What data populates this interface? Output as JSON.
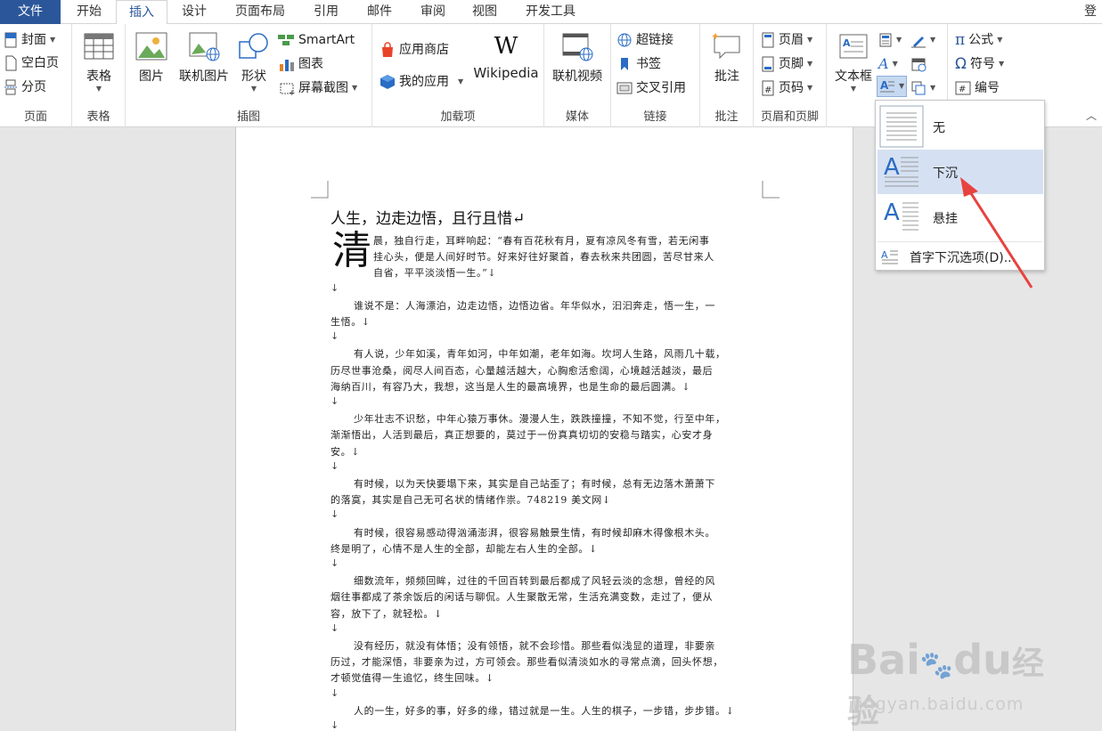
{
  "tabs": [
    {
      "label": "文件"
    },
    {
      "label": "开始"
    },
    {
      "label": "插入"
    },
    {
      "label": "设计"
    },
    {
      "label": "页面布局"
    },
    {
      "label": "引用"
    },
    {
      "label": "邮件"
    },
    {
      "label": "审阅"
    },
    {
      "label": "视图"
    },
    {
      "label": "开发工具"
    }
  ],
  "login": "登录",
  "ribbon": {
    "pages": {
      "cover": "封面",
      "blank": "空白页",
      "break": "分页",
      "label": "页面"
    },
    "table": {
      "table": "表格",
      "label": "表格"
    },
    "illustrations": {
      "picture": "图片",
      "online_picture": "联机图片",
      "shapes": "形状",
      "smartart": "SmartArt",
      "chart": "图表",
      "screenshot": "屏幕截图",
      "label": "插图"
    },
    "addins": {
      "store": "应用商店",
      "my_apps": "我的应用",
      "wikipedia": "Wikipedia",
      "label": "加载项"
    },
    "media": {
      "online_video": "联机视频",
      "label": "媒体"
    },
    "links": {
      "hyperlink": "超链接",
      "bookmark": "书签",
      "cross_ref": "交叉引用",
      "label": "链接"
    },
    "comments": {
      "comment": "批注",
      "label": "批注"
    },
    "header_footer": {
      "header": "页眉",
      "footer": "页脚",
      "page_number": "页码",
      "label": "页眉和页脚"
    },
    "text": {
      "textbox": "文本框"
    },
    "symbols": {
      "equation": "公式",
      "symbol": "符号",
      "numbering": "编号"
    }
  },
  "document": {
    "title": "人生，边走边悟，且行且惜↵",
    "dropcap": "清",
    "lines": [
      "晨，独自行走，耳畔响起：“春有百花秋有月，夏有凉风冬有雪，若无闲事",
      "挂心头，便是人间好时节。好来好往好聚首，春去秋来共团圆，苦尽甘来人",
      "自省，平平淡淡悟一生。”↓",
      "↓",
      "谁说不是：人海漂泊，边走边悟，边悟边省。年华似水，汩汩奔走，悟一生，一",
      "生悟。↓",
      "↓",
      "有人说，少年如溪，青年如河，中年如潮，老年如海。坎坷人生路，风雨几十载，",
      "历尽世事沧桑，阅尽人间百态，心量越活越大，心胸愈活愈阔，心境越活越淡，最后",
      "海纳百川，有容乃大，我想，这当是人生的最高境界，也是生命的最后圆满。↓",
      "↓",
      "少年壮志不识愁，中年心猿万事休。漫漫人生，跌跌撞撞，不知不觉，行至中年，",
      "渐渐悟出，人活到最后，真正想要的，莫过于一份真真切切的安稳与踏实，心安才身",
      "安。↓",
      "↓",
      "有时候，以为天快要塌下来，其实是自己站歪了；有时候，总有无边落木萧萧下",
      "的落寞，其实是自己无可名状的情绪作祟。748219 美文网↓",
      "↓",
      "有时候，很容易感动得汹涌澎湃，很容易触景生情，有时候却麻木得像根木头。",
      "终是明了，心情不是人生的全部，却能左右人生的全部。↓",
      "↓",
      "细数流年，频频回眸，过往的千回百转到最后都成了风轻云淡的念想，曾经的风",
      "烟往事都成了茶余饭后的闲话与聊侃。人生聚散无常，生活充满变数，走过了，便从",
      "容，放下了，就轻松。↓",
      "↓",
      "没有经历，就没有体悟；没有领悟，就不会珍惜。那些看似浅显的道理，非要亲",
      "历过，才能深悟，非要亲为过，方可领会。那些看似清淡如水的寻常点滴，回头怀想，",
      "才顿觉值得一生追忆，终生回味。↓",
      "↓",
      "人的一生，好多的事，好多的缘，错过就是一生。人生的棋子，一步错，步步错。↓",
      "↓"
    ]
  },
  "dropcap_menu": {
    "none": "无",
    "dropped": "下沉",
    "margin": "悬挂",
    "options": "首字下沉选项(D)..."
  },
  "watermark": {
    "brand": "Bai",
    "brand2": "du",
    "cn": "经验",
    "url": "jingyan.baidu.com"
  },
  "colors": {
    "accent": "#2b579a",
    "selected": "#d5e1f2",
    "arrow": "#e8423f"
  }
}
